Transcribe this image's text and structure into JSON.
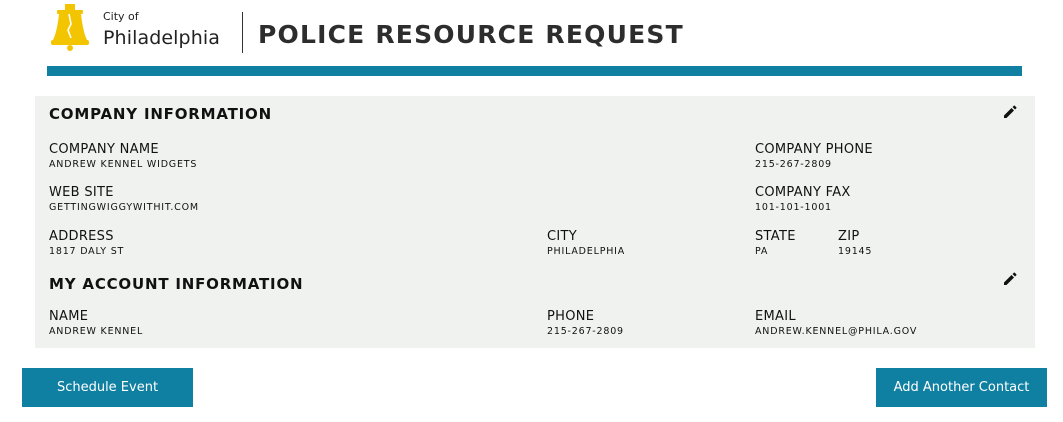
{
  "header": {
    "logo_small": "City of",
    "logo_big": "Philadelphia",
    "title": "POLICE RESOURCE REQUEST",
    "accent_color": "#0f7fa2",
    "logo_color": "#f2c500"
  },
  "company": {
    "heading": "COMPANY INFORMATION",
    "edit_icon": "pencil-icon",
    "name": {
      "label": "COMPANY NAME",
      "value": "ANDREW KENNEL WIDGETS"
    },
    "phone": {
      "label": "COMPANY PHONE",
      "value": "215-267-2809"
    },
    "website": {
      "label": "WEB SITE",
      "value": "GETTINGWIGGYWITHIT.COM"
    },
    "fax": {
      "label": "COMPANY FAX",
      "value": "101-101-1001"
    },
    "address": {
      "label": "ADDRESS",
      "value": "1817 DALY ST"
    },
    "city": {
      "label": "CITY",
      "value": "PHILADELPHIA"
    },
    "state": {
      "label": "STATE",
      "value": "PA"
    },
    "zip": {
      "label": "ZIP",
      "value": "19145"
    }
  },
  "account": {
    "heading": "MY ACCOUNT INFORMATION",
    "edit_icon": "pencil-icon",
    "name": {
      "label": "NAME",
      "value": "ANDREW KENNEL"
    },
    "phone": {
      "label": "PHONE",
      "value": "215-267-2809"
    },
    "email": {
      "label": "EMAIL",
      "value": "ANDREW.KENNEL@PHILA.GOV"
    }
  },
  "actions": {
    "schedule_label": "Schedule Event",
    "add_contact_label": "Add Another Contact"
  }
}
